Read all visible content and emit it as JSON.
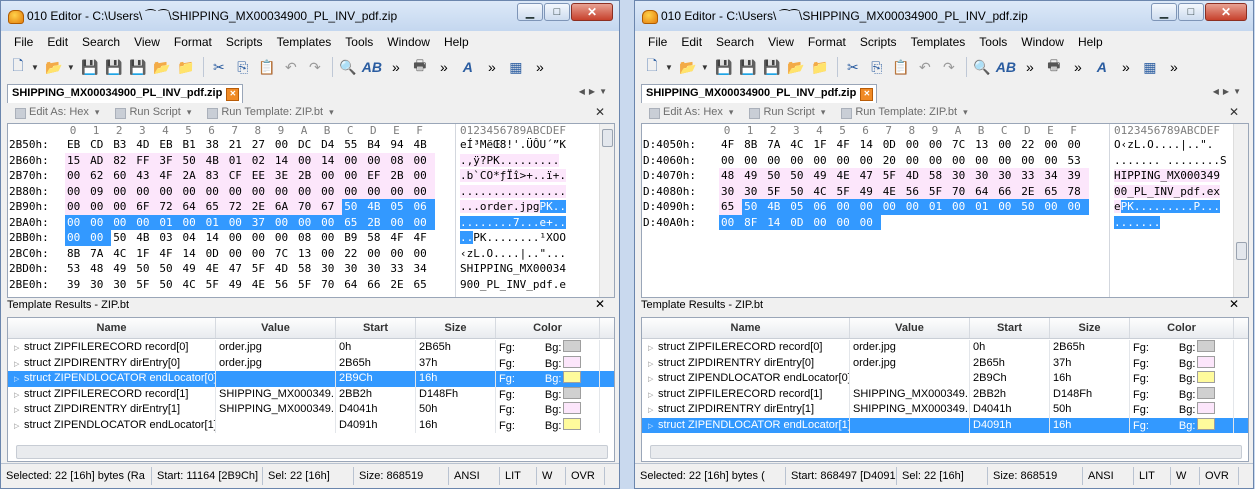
{
  "menu": [
    "File",
    "Edit",
    "Search",
    "View",
    "Format",
    "Scripts",
    "Templates",
    "Tools",
    "Window",
    "Help"
  ],
  "subtoolbar": [
    "Edit As: Hex",
    "Run Script",
    "Run Template: ZIP.bt"
  ],
  "tab": "SHIPPING_MX00034900_PL_INV_pdf.zip",
  "hex_header": [
    "0",
    "1",
    "2",
    "3",
    "4",
    "5",
    "6",
    "7",
    "8",
    "9",
    "A",
    "B",
    "C",
    "D",
    "E",
    "F"
  ],
  "ascii_header": "0123456789ABCDEF",
  "results_title": "Template Results - ZIP.bt",
  "results_columns": [
    "Name",
    "Value",
    "Start",
    "Size",
    "Color"
  ],
  "fg_label": "Fg:",
  "bg_label": "Bg:",
  "colors": {
    "pink": "#fce6fb",
    "white": "#ffffff",
    "select": "#3399ff",
    "yellow": "#fffb9c",
    "gray": "#d0d0d0"
  },
  "windows": [
    {
      "title": "010 Editor - C:\\Users\\ ⁀ ⁀\\SHIPPING_MX00034900_PL_INV_pdf.zip",
      "hex_rows": [
        {
          "addr": "2B50h:",
          "bytes": [
            "EB",
            "CD",
            "B3",
            "4D",
            "EB",
            "B1",
            "38",
            "21",
            "27",
            "00",
            "DC",
            "D4",
            "55",
            "B4",
            "94",
            "4B"
          ],
          "ascii": "eÍ³MëŒ8!'.ÜÔU´”K"
        },
        {
          "addr": "2B60h:",
          "bytes": [
            "15",
            "AD",
            "82",
            "FF",
            "3F",
            "50",
            "4B",
            "01",
            "02",
            "14",
            "00",
            "14",
            "00",
            "00",
            "08",
            "00"
          ],
          "ascii": ".­‚ÿ?PK........."
        },
        {
          "addr": "2B70h:",
          "bytes": [
            "00",
            "62",
            "60",
            "43",
            "4F",
            "2A",
            "83",
            "CF",
            "EE",
            "3E",
            "2B",
            "00",
            "00",
            "EF",
            "2B",
            "00"
          ],
          "ascii": ".b`CO*ƒÏî>+..ï+."
        },
        {
          "addr": "2B80h:",
          "bytes": [
            "00",
            "09",
            "00",
            "00",
            "00",
            "00",
            "00",
            "00",
            "00",
            "00",
            "00",
            "00",
            "00",
            "00",
            "00",
            "00"
          ],
          "ascii": "................"
        },
        {
          "addr": "2B90h:",
          "bytes": [
            "00",
            "00",
            "00",
            "6F",
            "72",
            "64",
            "65",
            "72",
            "2E",
            "6A",
            "70",
            "67",
            "50",
            "4B",
            "05",
            "06"
          ],
          "ascii": "...order.jpgPK.."
        },
        {
          "addr": "2BA0h:",
          "bytes": [
            "00",
            "00",
            "00",
            "00",
            "01",
            "00",
            "01",
            "00",
            "37",
            "00",
            "00",
            "00",
            "65",
            "2B",
            "00",
            "00"
          ],
          "ascii": "........7...e+.."
        },
        {
          "addr": "2BB0h:",
          "bytes": [
            "00",
            "00",
            "50",
            "4B",
            "03",
            "04",
            "14",
            "00",
            "00",
            "00",
            "08",
            "00",
            "B9",
            "58",
            "4F",
            "4F"
          ],
          "ascii": "..PK........¹XOO"
        },
        {
          "addr": "2BC0h:",
          "bytes": [
            "8B",
            "7A",
            "4C",
            "1F",
            "4F",
            "14",
            "0D",
            "00",
            "00",
            "7C",
            "13",
            "00",
            "22",
            "00",
            "00",
            "00"
          ],
          "ascii": "‹zL.O....|..\"..."
        },
        {
          "addr": "2BD0h:",
          "bytes": [
            "53",
            "48",
            "49",
            "50",
            "50",
            "49",
            "4E",
            "47",
            "5F",
            "4D",
            "58",
            "30",
            "30",
            "30",
            "33",
            "34"
          ],
          "ascii": "SHIPPING_MX00034"
        },
        {
          "addr": "2BE0h:",
          "bytes": [
            "39",
            "30",
            "30",
            "5F",
            "50",
            "4C",
            "5F",
            "49",
            "4E",
            "56",
            "5F",
            "70",
            "64",
            "66",
            "2E",
            "65"
          ],
          "ascii": "900_PL_INV_pdf.e"
        }
      ],
      "results": [
        {
          "name": "struct ZIPFILERECORD record[0]",
          "value": "order.jpg",
          "start": "0h",
          "size": "2B65h"
        },
        {
          "name": "struct ZIPDIRENTRY dirEntry[0]",
          "value": "order.jpg",
          "start": "2B65h",
          "size": "37h"
        },
        {
          "name": "struct ZIPENDLOCATOR endLocator[0]",
          "value": "",
          "start": "2B9Ch",
          "size": "16h"
        },
        {
          "name": "struct ZIPFILERECORD record[1]",
          "value": "SHIPPING_MX000349...",
          "start": "2BB2h",
          "size": "D148Fh"
        },
        {
          "name": "struct ZIPDIRENTRY dirEntry[1]",
          "value": "SHIPPING_MX000349...",
          "start": "D4041h",
          "size": "50h"
        },
        {
          "name": "struct ZIPENDLOCATOR endLocator[1]",
          "value": "",
          "start": "D4091h",
          "size": "16h"
        }
      ],
      "status": [
        "Selected: 22 [16h] bytes (Ra",
        "Start: 11164 [2B9Ch]",
        "Sel: 22 [16h]",
        "Size: 868519",
        "ANSI",
        "LIT",
        "W",
        "OVR"
      ]
    },
    {
      "title": "010 Editor - C:\\Users\\ ⁀⁀\\SHIPPING_MX00034900_PL_INV_pdf.zip",
      "hex_rows": [
        {
          "addr": "D:4050h:",
          "bytes": [
            "4F",
            "8B",
            "7A",
            "4C",
            "1F",
            "4F",
            "14",
            "0D",
            "00",
            "00",
            "7C",
            "13",
            "00",
            "22",
            "00",
            "00"
          ],
          "ascii": "O‹zL.O....|..\"."
        },
        {
          "addr": "D:4060h:",
          "bytes": [
            "00",
            "00",
            "00",
            "00",
            "00",
            "00",
            "00",
            "20",
            "00",
            "00",
            "00",
            "00",
            "00",
            "00",
            "00",
            "53"
          ],
          "ascii": "....... ........S"
        },
        {
          "addr": "D:4070h:",
          "bytes": [
            "48",
            "49",
            "50",
            "50",
            "49",
            "4E",
            "47",
            "5F",
            "4D",
            "58",
            "30",
            "30",
            "30",
            "33",
            "34",
            "39"
          ],
          "ascii": "HIPPING_MX000349"
        },
        {
          "addr": "D:4080h:",
          "bytes": [
            "30",
            "30",
            "5F",
            "50",
            "4C",
            "5F",
            "49",
            "4E",
            "56",
            "5F",
            "70",
            "64",
            "66",
            "2E",
            "65",
            "78"
          ],
          "ascii": "00_PL_INV_pdf.ex"
        },
        {
          "addr": "D:4090h:",
          "bytes": [
            "65",
            "50",
            "4B",
            "05",
            "06",
            "00",
            "00",
            "00",
            "00",
            "01",
            "00",
            "01",
            "00",
            "50",
            "00",
            "00"
          ],
          "ascii": "ePK.........P..."
        },
        {
          "addr": "D:40A0h:",
          "bytes": [
            "00",
            "8F",
            "14",
            "0D",
            "00",
            "00",
            "00",
            "",
            "",
            "",
            "",
            "",
            "",
            "",
            "",
            ""
          ],
          "ascii": "......."
        }
      ],
      "results": [
        {
          "name": "struct ZIPFILERECORD record[0]",
          "value": "order.jpg",
          "start": "0h",
          "size": "2B65h"
        },
        {
          "name": "struct ZIPDIRENTRY dirEntry[0]",
          "value": "order.jpg",
          "start": "2B65h",
          "size": "37h"
        },
        {
          "name": "struct ZIPENDLOCATOR endLocator[0]",
          "value": "",
          "start": "2B9Ch",
          "size": "16h"
        },
        {
          "name": "struct ZIPFILERECORD record[1]",
          "value": "SHIPPING_MX000349...",
          "start": "2BB2h",
          "size": "D148Fh"
        },
        {
          "name": "struct ZIPDIRENTRY dirEntry[1]",
          "value": "SHIPPING_MX000349...",
          "start": "D4041h",
          "size": "50h"
        },
        {
          "name": "struct ZIPENDLOCATOR endLocator[1]",
          "value": "",
          "start": "D4091h",
          "size": "16h"
        }
      ],
      "status": [
        "Selected: 22 [16h] bytes (",
        "Start: 868497 [D4091h]",
        "Sel: 22 [16h]",
        "Size: 868519",
        "ANSI",
        "LIT",
        "W",
        "OVR"
      ]
    }
  ]
}
